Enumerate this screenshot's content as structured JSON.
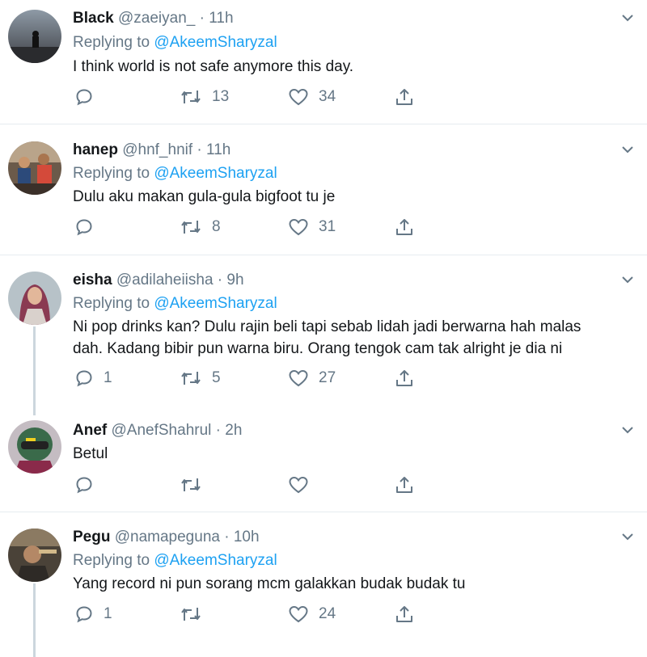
{
  "tweets": [
    {
      "name": "Black",
      "handle": "@zaeiyan_",
      "time": "11h",
      "replying_prefix": "Replying to",
      "replying_handle": "@AkeemSharyzal",
      "text": "I think world is not safe anymore this day.",
      "replies": "",
      "retweets": "13",
      "likes": "34",
      "avatar": "silhouette-dusk"
    },
    {
      "name": "hanep",
      "handle": "@hnf_hnif",
      "time": "11h",
      "replying_prefix": "Replying to",
      "replying_handle": "@AkeemSharyzal",
      "text": "Dulu aku makan gula-gula bigfoot tu je",
      "replies": "",
      "retweets": "8",
      "likes": "31",
      "avatar": "group-photo"
    },
    {
      "name": "eisha",
      "handle": "@adilaheiisha",
      "time": "9h",
      "replying_prefix": "Replying to",
      "replying_handle": "@AkeemSharyzal",
      "text_line1": "Ni pop drinks kan? Dulu rajin beli tapi sebab lidah jadi berwarna hah malas",
      "text_line2": "dah. Kadang bibir pun warna biru. Orang tengok cam tak alright je dia ni",
      "replies": "1",
      "retweets": "5",
      "likes": "27",
      "avatar": "woman-hijab"
    },
    {
      "name": "Anef",
      "handle": "@AnefShahrul",
      "time": "2h",
      "text": "Betul",
      "replies": "",
      "retweets": "",
      "likes": "",
      "avatar": "helmet-rider"
    },
    {
      "name": "Pegu",
      "handle": "@namapeguna",
      "time": "10h",
      "replying_prefix": "Replying to",
      "replying_handle": "@AkeemSharyzal",
      "text": "Yang record ni pun sorang mcm galakkan budak budak tu",
      "replies": "1",
      "retweets": "",
      "likes": "24",
      "avatar": "man-photo"
    }
  ],
  "colors": {
    "text": "#14171a",
    "secondary": "#657786",
    "link": "#1da1f2",
    "divider": "#e6ecf0",
    "thread": "#ccd6dd"
  },
  "icons": [
    "reply-icon",
    "retweet-icon",
    "like-icon",
    "share-icon",
    "chevron-down-icon"
  ]
}
